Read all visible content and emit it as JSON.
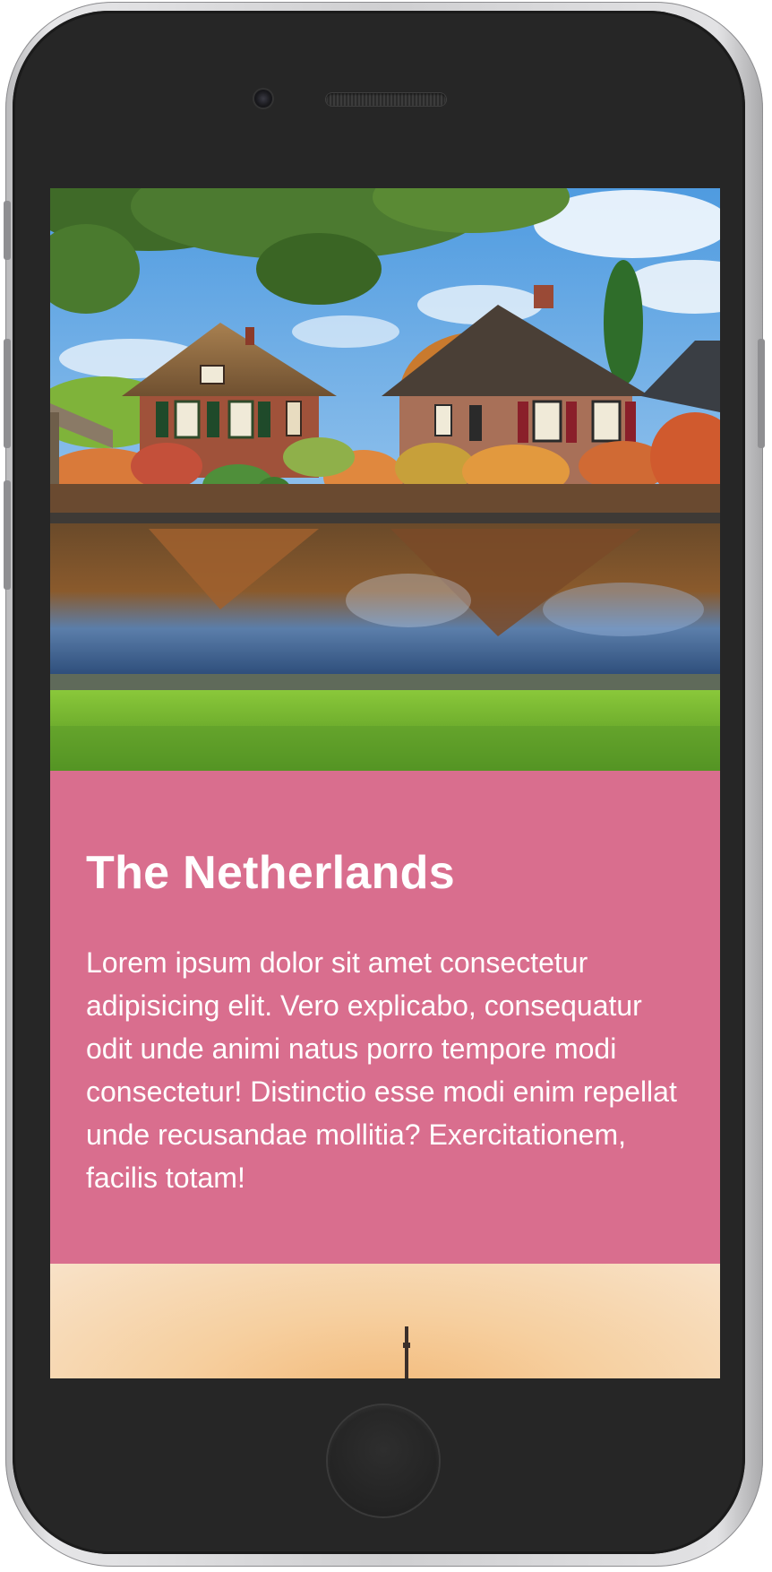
{
  "card": {
    "title": "The Netherlands",
    "text": "Lorem ipsum dolor sit amet consectetur adipisicing elit. Vero explicabo, consequatur odit unde animi natus porro tempore modi consectetur! Distinctio esse modi enim repellat unde recusandae mollitia? Exercitationem, facilis totam!"
  },
  "colors": {
    "card_background": "#d96e8e",
    "card_text": "#ffffff",
    "phone_body": "#262626"
  },
  "images": {
    "hero": "landscape-photo-thatched-houses-canal",
    "next_section": "sunset-sky-with-tower"
  }
}
